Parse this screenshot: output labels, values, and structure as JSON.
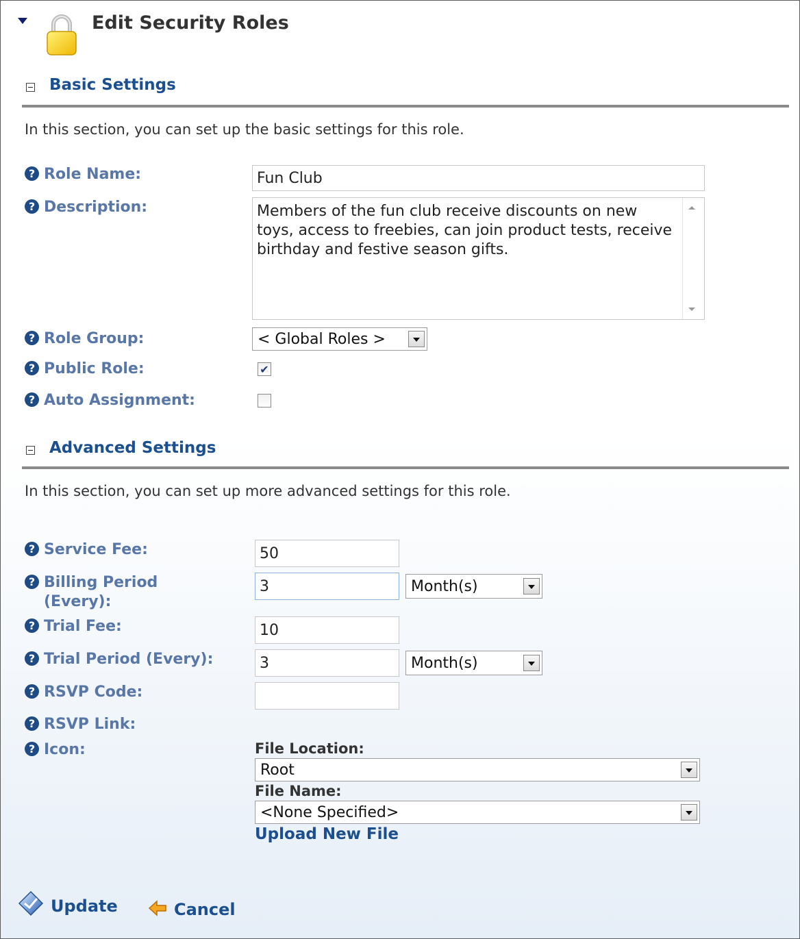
{
  "header": {
    "title": "Edit Security Roles",
    "icon": "lock-icon"
  },
  "basic": {
    "title": "Basic Settings",
    "description": "In this section, you can set up the basic settings for this role.",
    "role_name_label": "Role Name:",
    "role_name_value": "Fun Club",
    "description_label": "Description:",
    "description_value": "Members of the fun club receive discounts on new toys, access to freebies, can join product tests, receive birthday and festive season gifts.",
    "role_group_label": "Role Group:",
    "role_group_value": "< Global Roles >",
    "public_role_label": "Public Role:",
    "public_role_checked": true,
    "auto_assignment_label": "Auto Assignment:",
    "auto_assignment_checked": false
  },
  "advanced": {
    "title": "Advanced Settings",
    "description": "In this section, you can set up more advanced settings for this role.",
    "service_fee_label": "Service Fee:",
    "service_fee_value": "50",
    "billing_period_label_1": "Billing Period",
    "billing_period_label_2": "(Every):",
    "billing_period_value": "3",
    "billing_period_unit": "Month(s)",
    "trial_fee_label": "Trial Fee:",
    "trial_fee_value": "10",
    "trial_period_label": "Trial Period (Every):",
    "trial_period_value": "3",
    "trial_period_unit": "Month(s)",
    "rsvp_code_label": "RSVP Code:",
    "rsvp_code_value": "",
    "rsvp_link_label": "RSVP Link:",
    "icon_label": "Icon:",
    "file_location_label": "File Location:",
    "file_location_value": "Root",
    "file_name_label": "File Name:",
    "file_name_value": "<None Specified>",
    "upload_link": "Upload New File"
  },
  "actions": {
    "update_label": "Update",
    "cancel_label": "Cancel"
  },
  "help_glyph": "?",
  "colors": {
    "link": "#1b4f8f",
    "label": "#5877a7",
    "help": "#1f4b84"
  }
}
